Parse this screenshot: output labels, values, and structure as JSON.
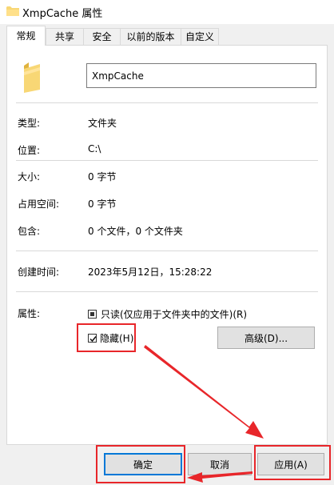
{
  "window": {
    "title": "XmpCache 属性"
  },
  "tabs": [
    {
      "label": "常规"
    },
    {
      "label": "共享"
    },
    {
      "label": "安全"
    },
    {
      "label": "以前的版本"
    },
    {
      "label": "自定义"
    }
  ],
  "folder_name": "XmpCache",
  "properties": {
    "type": {
      "label": "类型:",
      "value": "文件夹"
    },
    "location": {
      "label": "位置:",
      "value": "C:\\"
    },
    "size": {
      "label": "大小:",
      "value": "0 字节"
    },
    "size_on_disk": {
      "label": "占用空间:",
      "value": "0 字节"
    },
    "contains": {
      "label": "包含:",
      "value": "0 个文件，0 个文件夹"
    },
    "created": {
      "label": "创建时间:",
      "value": "2023年5月12日，15:28:22"
    }
  },
  "attributes": {
    "label": "属性:",
    "readonly": {
      "label": "只读(仅应用于文件夹中的文件)(R)",
      "state": "indeterminate"
    },
    "hidden": {
      "label": "隐藏(H)",
      "checked": true
    },
    "advanced_label": "高级(D)..."
  },
  "buttons": {
    "ok": "确定",
    "cancel": "取消",
    "apply": "应用(A)"
  },
  "annotation_color": "#e8262a",
  "accent_color": "#0078d7",
  "folder_color": "#f8d775"
}
